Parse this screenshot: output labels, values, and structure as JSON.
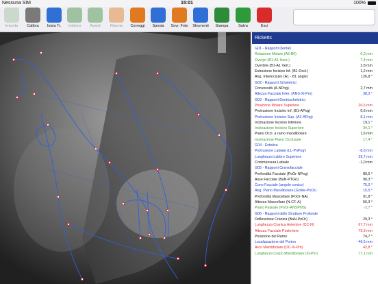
{
  "status": {
    "carrier": "Nessuna SIM",
    "time": "15:01",
    "battery": "100%"
  },
  "toolbar": {
    "buttons": [
      {
        "label": "Importa",
        "enabled": false,
        "icon": "import-icon",
        "color": "#9fbf9f"
      },
      {
        "label": "Calibra",
        "enabled": true,
        "icon": "ruler-icon",
        "color": "#7a7a7a"
      },
      {
        "label": "Inizia Tr.",
        "enabled": true,
        "icon": "start-tracing-icon",
        "color": "#2f6fd6"
      },
      {
        "label": "Indietro",
        "enabled": false,
        "icon": "undo-icon",
        "color": "#3f8f3f"
      },
      {
        "label": "Avanti",
        "enabled": false,
        "icon": "redo-icon",
        "color": "#3f8f3f"
      },
      {
        "label": "Riavvia",
        "enabled": false,
        "icon": "restart-icon",
        "color": "#e07a20"
      },
      {
        "label": "Correggi",
        "enabled": true,
        "icon": "correct-icon",
        "color": "#e07a20"
      },
      {
        "label": "Sposta",
        "enabled": true,
        "icon": "move-icon",
        "color": "#2f6fd6"
      },
      {
        "label": "Sovr. Foto",
        "enabled": true,
        "icon": "overlay-photo-icon",
        "color": "#e07a20"
      },
      {
        "label": "Strumenti",
        "enabled": true,
        "icon": "tools-icon",
        "color": "#2f6fd6"
      },
      {
        "label": "Stampa",
        "enabled": true,
        "icon": "printer-icon",
        "color": "#2e8b3a"
      },
      {
        "label": "Salva",
        "enabled": true,
        "icon": "checkmark-icon",
        "color": "#2e9b3a"
      },
      {
        "label": "Esci",
        "enabled": true,
        "icon": "exit-icon",
        "color": "#d92b2b"
      }
    ]
  },
  "panel": {
    "title": "Ricketts",
    "rows": [
      {
        "t": "G01 - Rapporti Dentali",
        "v": "",
        "c": "grp"
      },
      {
        "t": "Relazione Molare (A6-B6)",
        "v": "0,3 mm",
        "c": "g"
      },
      {
        "t": "Overjet (B1-A1 Horz.)",
        "v": "7,4 mm",
        "c": "g"
      },
      {
        "t": "Overbite (B1-A1 Vert.)",
        "v": "2,8 mm",
        "c": "k"
      },
      {
        "t": "Estrusione Incisivo Inf. (B1-Occl.)",
        "v": "1,2 mm",
        "c": "k"
      },
      {
        "t": "Ang. Interincisivo (A1 - B1 angle)",
        "v": "126,8 °",
        "c": "k"
      },
      {
        "t": "G02 - Rapporti Scheletrici",
        "v": "",
        "c": "grp"
      },
      {
        "t": "Convessità (A-NPog)",
        "v": "2,7 mm",
        "c": "k"
      },
      {
        "t": "Altezza Facciale Infer. (ANS-Xi-Pm)",
        "v": "38,3 °",
        "c": "b"
      },
      {
        "t": "G03 - Rapporti Dentoscheletrici",
        "v": "",
        "c": "grp"
      },
      {
        "t": "Posizione Molare Superiore",
        "v": "26,6 mm",
        "c": "r"
      },
      {
        "t": "Protrusione Incisivo Inf. (B1-APog)",
        "v": "0,6 mm",
        "c": "k"
      },
      {
        "t": "Protrusione Incisivo Sup. (A1-APog)",
        "v": "8,1 mm",
        "c": "b"
      },
      {
        "t": "Inclinazione Incisivo Inferiore",
        "v": "19,1 °",
        "c": "k"
      },
      {
        "t": "Inclinazione Incisivo Superiore",
        "v": "34,1 °",
        "c": "g"
      },
      {
        "t": "Piano Occl. a ramo mandibolare",
        "v": "1,6 mm",
        "c": "k"
      },
      {
        "t": "Inclinazione Piano Occlusale",
        "v": "17,4 °",
        "c": "g"
      },
      {
        "t": "G04 - Estetica",
        "v": "",
        "c": "grp"
      },
      {
        "t": "Protrusione Labiale (LL-PnPog')",
        "v": "-8,6 mm",
        "c": "b"
      },
      {
        "t": "Lunghezza Labbro Superiore",
        "v": "29,7 mm",
        "c": "b"
      },
      {
        "t": "Commessura Labiale",
        "v": "-1,0 mm",
        "c": "k"
      },
      {
        "t": "G05 - Rapporti Craniofacciale",
        "v": "",
        "c": "grp"
      },
      {
        "t": "Profondità Facciale (PoOr-NPog)",
        "v": "89,5 °",
        "c": "k"
      },
      {
        "t": "Asse Facciale (BaN-PTGn)",
        "v": "90,3 °",
        "c": "k"
      },
      {
        "t": "Cono Facciale (angolo conico)",
        "v": "75,0 °",
        "c": "b"
      },
      {
        "t": "Ang. Piano Mandibolare (GoMe-PoOr)",
        "v": "15,5 °",
        "c": "b"
      },
      {
        "t": "Profondità Mascellare (PoOr-NA)",
        "v": "91,8 °",
        "c": "k"
      },
      {
        "t": "Altezza Mascellare (N-CF-A)",
        "v": "56,3 °",
        "c": "k"
      },
      {
        "t": "Piano Palatale (PoOr-ANSPNS)",
        "v": "-2,7 °",
        "c": "g"
      },
      {
        "t": "G06 - Rapporti delle Strutture Profonde",
        "v": "",
        "c": "grp"
      },
      {
        "t": "Deflessione Cranica (BaN-PoOr)",
        "v": "29,3 °",
        "c": "k"
      },
      {
        "t": "Lunghezza Cranica Anteriore (CC-N)",
        "v": "67,7 mm",
        "c": "r"
      },
      {
        "t": "Altezza Facciale Posteriore",
        "v": "79,9 mm",
        "c": "r"
      },
      {
        "t": "Posizione del Ramo",
        "v": "74,7 °",
        "c": "k"
      },
      {
        "t": "Localizzazione del Porion",
        "v": "-46,6 mm",
        "c": "b"
      },
      {
        "t": "Arco Mandibolare (DC-Xi-Pm)",
        "v": "42,8 °",
        "c": "r"
      },
      {
        "t": "Lunghezza Corpo Mandibolare (Xi-Pm)",
        "v": "77,1 mm",
        "c": "g"
      }
    ]
  }
}
